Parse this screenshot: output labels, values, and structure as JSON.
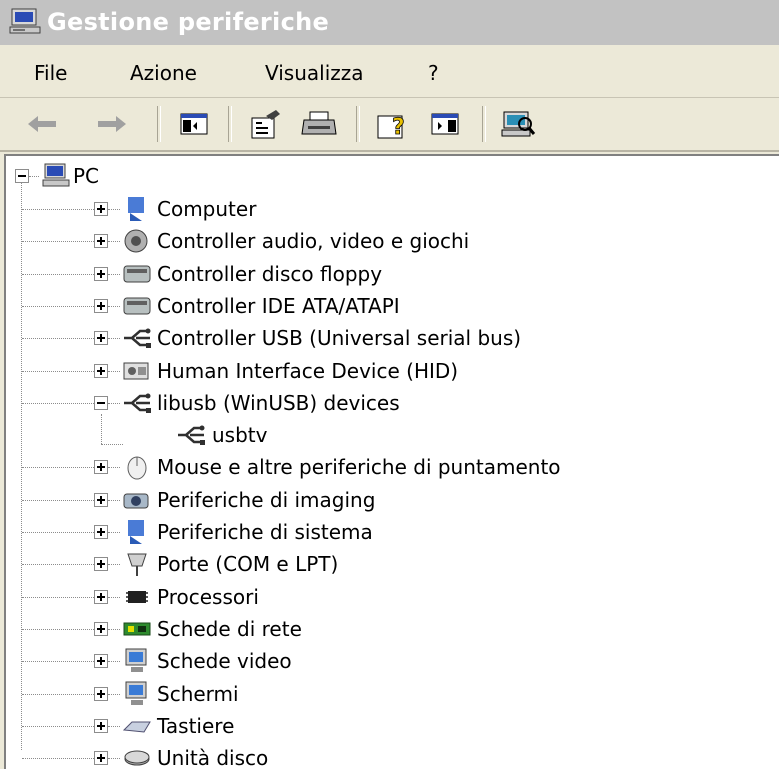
{
  "window": {
    "title": "Gestione periferiche"
  },
  "menu": [
    {
      "label": "File"
    },
    {
      "label": "Azione"
    },
    {
      "label": "Visualizza"
    },
    {
      "label": "?"
    }
  ],
  "toolbar": [
    {
      "icon": "back-arrow-icon"
    },
    {
      "icon": "forward-arrow-icon"
    },
    {
      "icon": "show-hide-console-tree-icon"
    },
    {
      "icon": "properties-icon"
    },
    {
      "icon": "print-icon"
    },
    {
      "icon": "help-icon"
    },
    {
      "icon": "show-hide-action-pane-icon"
    },
    {
      "icon": "scan-hardware-changes-icon"
    }
  ],
  "tree": {
    "root": {
      "label": "PC",
      "icon": "computer-icon",
      "expanded": true
    },
    "items": [
      {
        "label": "Computer",
        "icon": "computer-icon",
        "expanded": false
      },
      {
        "label": "Controller audio, video e giochi",
        "icon": "speaker-icon",
        "expanded": false
      },
      {
        "label": "Controller disco floppy",
        "icon": "floppy-controller-icon",
        "expanded": false
      },
      {
        "label": "Controller IDE ATA/ATAPI",
        "icon": "ide-controller-icon",
        "expanded": false
      },
      {
        "label": "Controller USB (Universal serial bus)",
        "icon": "usb-icon",
        "expanded": false
      },
      {
        "label": "Human Interface Device (HID)",
        "icon": "hid-icon",
        "expanded": false
      },
      {
        "label": "libusb (WinUSB) devices",
        "icon": "usb-icon",
        "expanded": true,
        "children": [
          {
            "label": "usbtv",
            "icon": "usb-icon"
          }
        ]
      },
      {
        "label": "Mouse e altre periferiche di puntamento",
        "icon": "mouse-icon",
        "expanded": false
      },
      {
        "label": "Periferiche di imaging",
        "icon": "camera-icon",
        "expanded": false
      },
      {
        "label": "Periferiche di sistema",
        "icon": "system-device-icon",
        "expanded": false
      },
      {
        "label": "Porte (COM e LPT)",
        "icon": "port-icon",
        "expanded": false
      },
      {
        "label": "Processori",
        "icon": "processor-icon",
        "expanded": false
      },
      {
        "label": "Schede di rete",
        "icon": "network-card-icon",
        "expanded": false
      },
      {
        "label": "Schede video",
        "icon": "display-adapter-icon",
        "expanded": false
      },
      {
        "label": "Schermi",
        "icon": "monitor-icon",
        "expanded": false
      },
      {
        "label": "Tastiere",
        "icon": "keyboard-icon",
        "expanded": false
      },
      {
        "label": "Unità disco",
        "icon": "disk-drive-icon",
        "expanded": false
      }
    ]
  },
  "colors": {
    "titlebar_bg": "#c2c2c2",
    "window_bg": "#ece9d8",
    "tree_bg": "#ffffff"
  }
}
